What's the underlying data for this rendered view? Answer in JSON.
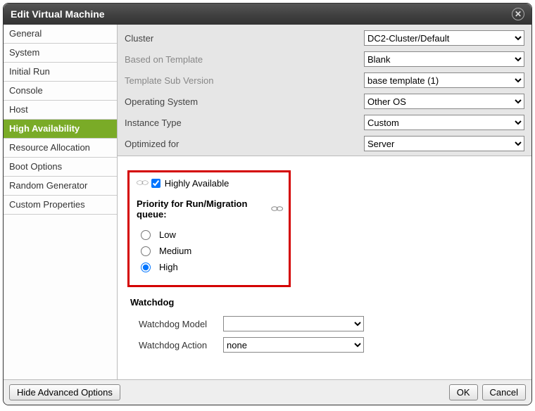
{
  "dialog": {
    "title": "Edit Virtual Machine"
  },
  "sidebar": {
    "items": [
      {
        "label": "General"
      },
      {
        "label": "System"
      },
      {
        "label": "Initial Run"
      },
      {
        "label": "Console"
      },
      {
        "label": "Host"
      },
      {
        "label": "High Availability",
        "active": true
      },
      {
        "label": "Resource Allocation"
      },
      {
        "label": "Boot Options"
      },
      {
        "label": "Random Generator"
      },
      {
        "label": "Custom Properties"
      }
    ]
  },
  "top_form": {
    "rows": [
      {
        "label": "Cluster",
        "value": "DC2-Cluster/Default",
        "disabled": false
      },
      {
        "label": "Based on Template",
        "value": "Blank",
        "disabled": true
      },
      {
        "label": "Template Sub Version",
        "value": "base template (1)",
        "disabled": true
      },
      {
        "label": "Operating System",
        "value": "Other OS",
        "disabled": false
      },
      {
        "label": "Instance Type",
        "value": "Custom",
        "disabled": false
      },
      {
        "label": "Optimized for",
        "value": "Server",
        "disabled": false
      }
    ]
  },
  "ha": {
    "checkbox_label": "Highly Available",
    "checked": true,
    "priority_heading": "Priority for Run/Migration queue:",
    "options": [
      {
        "label": "Low",
        "selected": false
      },
      {
        "label": "Medium",
        "selected": false
      },
      {
        "label": "High",
        "selected": true
      }
    ]
  },
  "watchdog": {
    "heading": "Watchdog",
    "model_label": "Watchdog Model",
    "model_value": "",
    "action_label": "Watchdog Action",
    "action_value": "none"
  },
  "footer": {
    "advanced": "Hide Advanced Options",
    "ok": "OK",
    "cancel": "Cancel"
  }
}
